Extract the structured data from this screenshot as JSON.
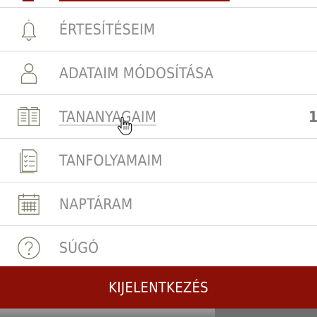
{
  "menu": {
    "items": [
      {
        "label": "ÉRTESÍTÉSEIM",
        "icon": "bell-icon"
      },
      {
        "label": "ADATAIM MÓDOSÍTÁSA",
        "icon": "user-icon"
      },
      {
        "label": "TANANYAGAIM",
        "icon": "book-icon",
        "count": "1"
      },
      {
        "label": "TANFOLYAMAIM",
        "icon": "checklist-icon"
      },
      {
        "label": "NAPTÁRAM",
        "icon": "calendar-icon"
      },
      {
        "label": "SÚGÓ",
        "icon": "help-icon"
      }
    ]
  },
  "logout": {
    "label": "KIJELENTKEZÉS"
  },
  "colors": {
    "accent": "#8b1108",
    "text": "#8a8a8a",
    "icon": "#7b7b66",
    "divider": "#d7d7d7"
  }
}
